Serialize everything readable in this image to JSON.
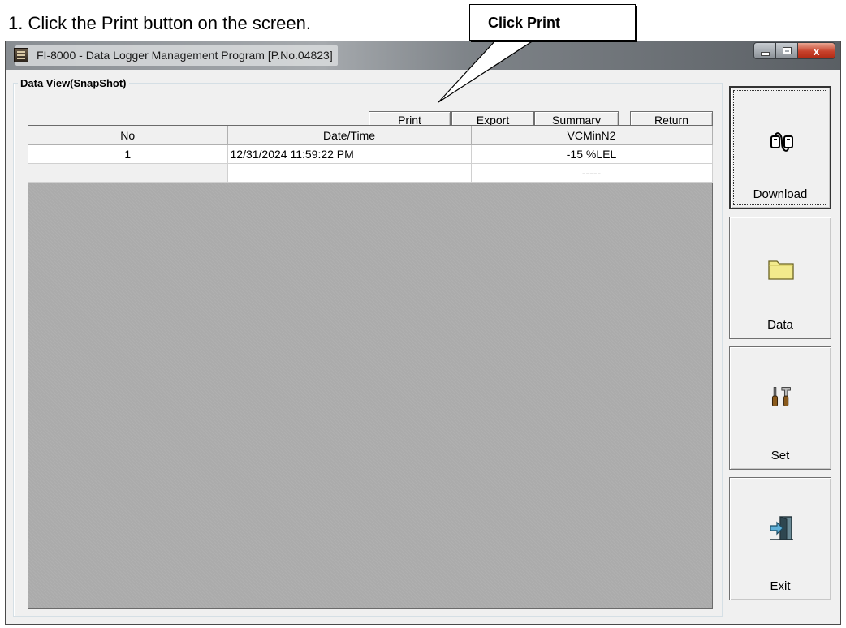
{
  "instruction": "1. Click the Print button on the screen.",
  "callout": {
    "text": "Click Print"
  },
  "window": {
    "title": "FI-8000  - Data Logger Management Program [P.No.04823]",
    "close_glyph": "x"
  },
  "data_view": {
    "legend": "Data View(SnapShot)",
    "buttons": {
      "print": "Print",
      "export": "Export",
      "summary": "Summary",
      "return": "Return"
    },
    "columns": [
      "No",
      "Date/Time",
      "VCMinN2"
    ],
    "rows": [
      {
        "no": "1",
        "datetime": "12/31/2024 11:59:22 PM",
        "value": "-15 %LEL"
      },
      {
        "no": "",
        "datetime": "",
        "value": "-----"
      }
    ]
  },
  "side_buttons": {
    "download": {
      "label": "Download",
      "icon": "connector-icon"
    },
    "data": {
      "label": "Data",
      "icon": "folder-icon"
    },
    "set": {
      "label": "Set",
      "icon": "tools-icon"
    },
    "exit": {
      "label": "Exit",
      "icon": "exit-door-icon"
    }
  },
  "colors": {
    "grid_background": "#ababab",
    "close_button": "#c7412b",
    "folder": "#f2ea8c"
  }
}
